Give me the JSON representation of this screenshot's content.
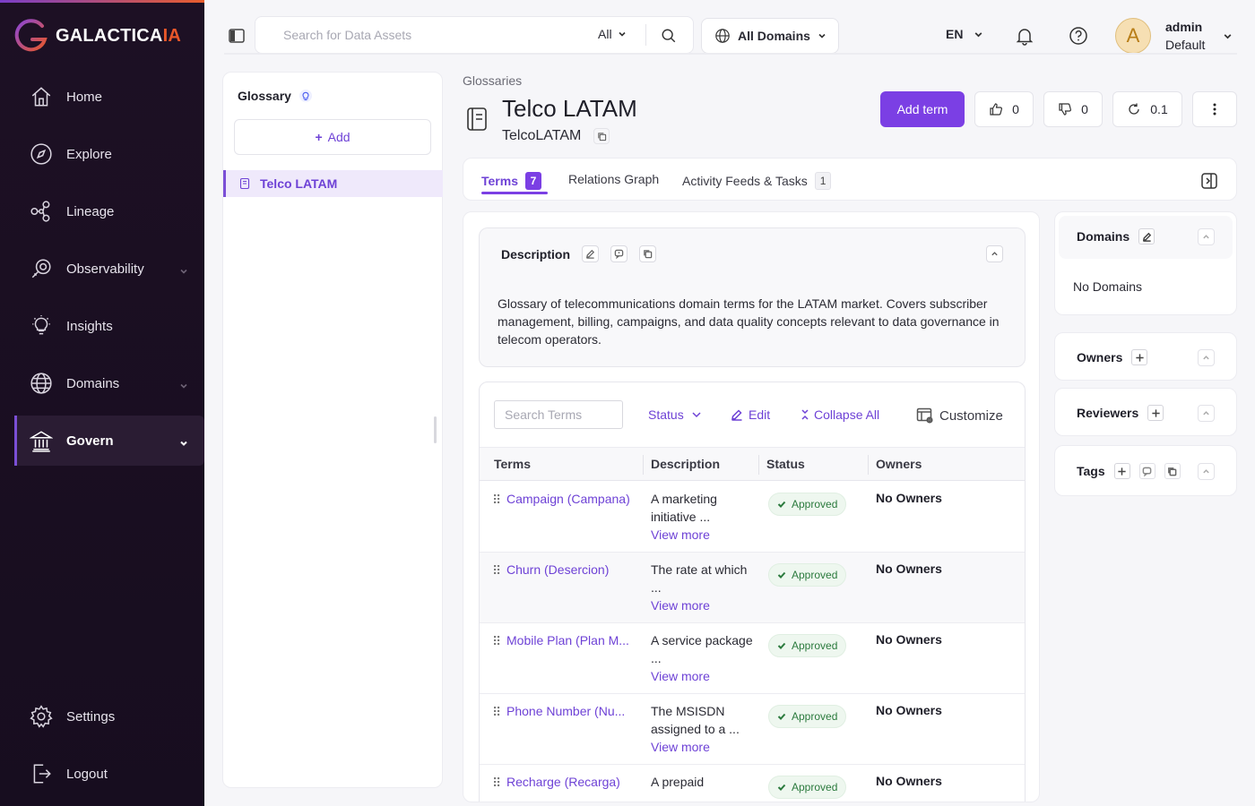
{
  "brand": {
    "name_main": "GALACTICA",
    "name_accent": "IA"
  },
  "sidebar": {
    "items": [
      {
        "label": "Home"
      },
      {
        "label": "Explore"
      },
      {
        "label": "Lineage"
      },
      {
        "label": "Observability"
      },
      {
        "label": "Insights"
      },
      {
        "label": "Domains"
      },
      {
        "label": "Govern"
      }
    ],
    "bottom": [
      {
        "label": "Settings"
      },
      {
        "label": "Logout"
      }
    ]
  },
  "topbar": {
    "search_placeholder": "Search for Data Assets",
    "search_scope": "All",
    "domains_label": "All Domains",
    "language": "EN",
    "avatar_letter": "A",
    "user_name": "admin",
    "user_role": "Default"
  },
  "glossary_panel": {
    "title": "Glossary",
    "add_label": "Add",
    "items": [
      {
        "label": "Telco LATAM",
        "selected": true
      }
    ]
  },
  "header": {
    "breadcrumb": "Glossaries",
    "title": "Telco LATAM",
    "subtitle": "TelcoLATAM",
    "add_term_label": "Add term",
    "likes": "0",
    "dislikes": "0",
    "version": "0.1"
  },
  "tabs": [
    {
      "label": "Terms",
      "badge": "7",
      "active": true
    },
    {
      "label": "Relations Graph"
    },
    {
      "label": "Activity Feeds & Tasks",
      "badge": "1"
    }
  ],
  "description": {
    "title": "Description",
    "text": "Glossary of telecommunications domain terms for the LATAM market. Covers subscriber management, billing, campaigns, and data quality concepts relevant to data governance in telecom operators."
  },
  "terms": {
    "search_placeholder": "Search Terms",
    "toolbar": {
      "status_label": "Status",
      "edit_label": "Edit",
      "collapse_label": "Collapse All",
      "customize_label": "Customize"
    },
    "columns": [
      "Terms",
      "Description",
      "Status",
      "Owners"
    ],
    "rows": [
      {
        "name": "Campaign (Campana)",
        "desc": "A marketing initiative ...",
        "more": "View more",
        "status": "Approved",
        "owners": "No Owners"
      },
      {
        "name": "Churn (Desercion)",
        "desc": "The rate at which ...",
        "more": "View more",
        "status": "Approved",
        "owners": "No Owners"
      },
      {
        "name": "Mobile Plan (Plan M...",
        "desc": "A service package ...",
        "more": "View more",
        "status": "Approved",
        "owners": "No Owners"
      },
      {
        "name": "Phone Number (Nu...",
        "desc": "The MSISDN assigned to a ...",
        "more": "View more",
        "status": "Approved",
        "owners": "No Owners"
      },
      {
        "name": "Recharge (Recarga)",
        "desc": "A prepaid",
        "more": "",
        "status": "Approved",
        "owners": "No Owners"
      }
    ]
  },
  "right_panel": {
    "domains_title": "Domains",
    "domains_value": "No Domains",
    "owners_title": "Owners",
    "reviewers_title": "Reviewers",
    "tags_title": "Tags"
  },
  "colors": {
    "accent": "#7b3fe4",
    "sidebar_bg": "#1d1024",
    "brand_orange": "#e8572a",
    "approved_green": "#2b7a3d"
  }
}
